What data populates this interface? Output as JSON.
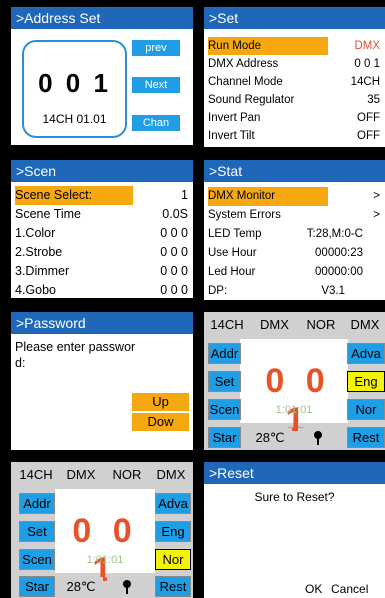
{
  "address_set": {
    "title": ">Address Set",
    "address": "0 0 1",
    "mode": "14CH 01.01",
    "buttons": {
      "prev": "prev",
      "next": "Next",
      "chan": "Chan"
    }
  },
  "set": {
    "title": ">Set",
    "rows": [
      {
        "label": "Run Mode",
        "value": "DMX"
      },
      {
        "label": "DMX Address",
        "value": "0 0 1"
      },
      {
        "label": "Channel Mode",
        "value": "14CH"
      },
      {
        "label": "Sound Regulator",
        "value": "35"
      },
      {
        "label": "Invert Pan",
        "value": "OFF"
      },
      {
        "label": "Invert Tilt",
        "value": "OFF"
      }
    ]
  },
  "scen": {
    "title": ">Scen",
    "rows": [
      {
        "label": "Scene Select:",
        "value": "1"
      },
      {
        "label": "Scene Time",
        "value": "0.0S"
      },
      {
        "label": "1.Color",
        "value": "0 0 0"
      },
      {
        "label": "2.Strobe",
        "value": "0 0 0"
      },
      {
        "label": "3.Dimmer",
        "value": "0 0 0"
      },
      {
        "label": "4.Gobo",
        "value": "0 0 0"
      }
    ]
  },
  "stat": {
    "title": ">Stat",
    "rows": [
      {
        "label": "DMX Monitor",
        "value": ">"
      },
      {
        "label": "System Errors",
        "value": ">"
      },
      {
        "label": "LED Temp",
        "value": "T:28,M:0-C"
      },
      {
        "label": "Use Hour",
        "value": "00000:23"
      },
      {
        "label": "Led Hour",
        "value": "00000:00"
      },
      {
        "label": "DP:",
        "value": "V3.1"
      }
    ]
  },
  "password": {
    "title": ">Password",
    "prompt_line1": "Please enter passwor",
    "prompt_line2": "d:",
    "up": "Up",
    "down": "Dow"
  },
  "main": {
    "top": [
      "14CH",
      "DMX",
      "NOR",
      "DMX"
    ],
    "left": [
      "Addr",
      "Set",
      "Scen",
      "Star"
    ],
    "right": [
      "Adva",
      "Eng",
      "Nor",
      "Rest"
    ],
    "address": "0 0 1",
    "time": "1:01:01",
    "temp": "28℃",
    "lamp_icon": "pin-icon"
  },
  "reset": {
    "title": ">Reset",
    "question": "Sure to Reset?",
    "ok": "OK",
    "cancel": "Cancel"
  }
}
